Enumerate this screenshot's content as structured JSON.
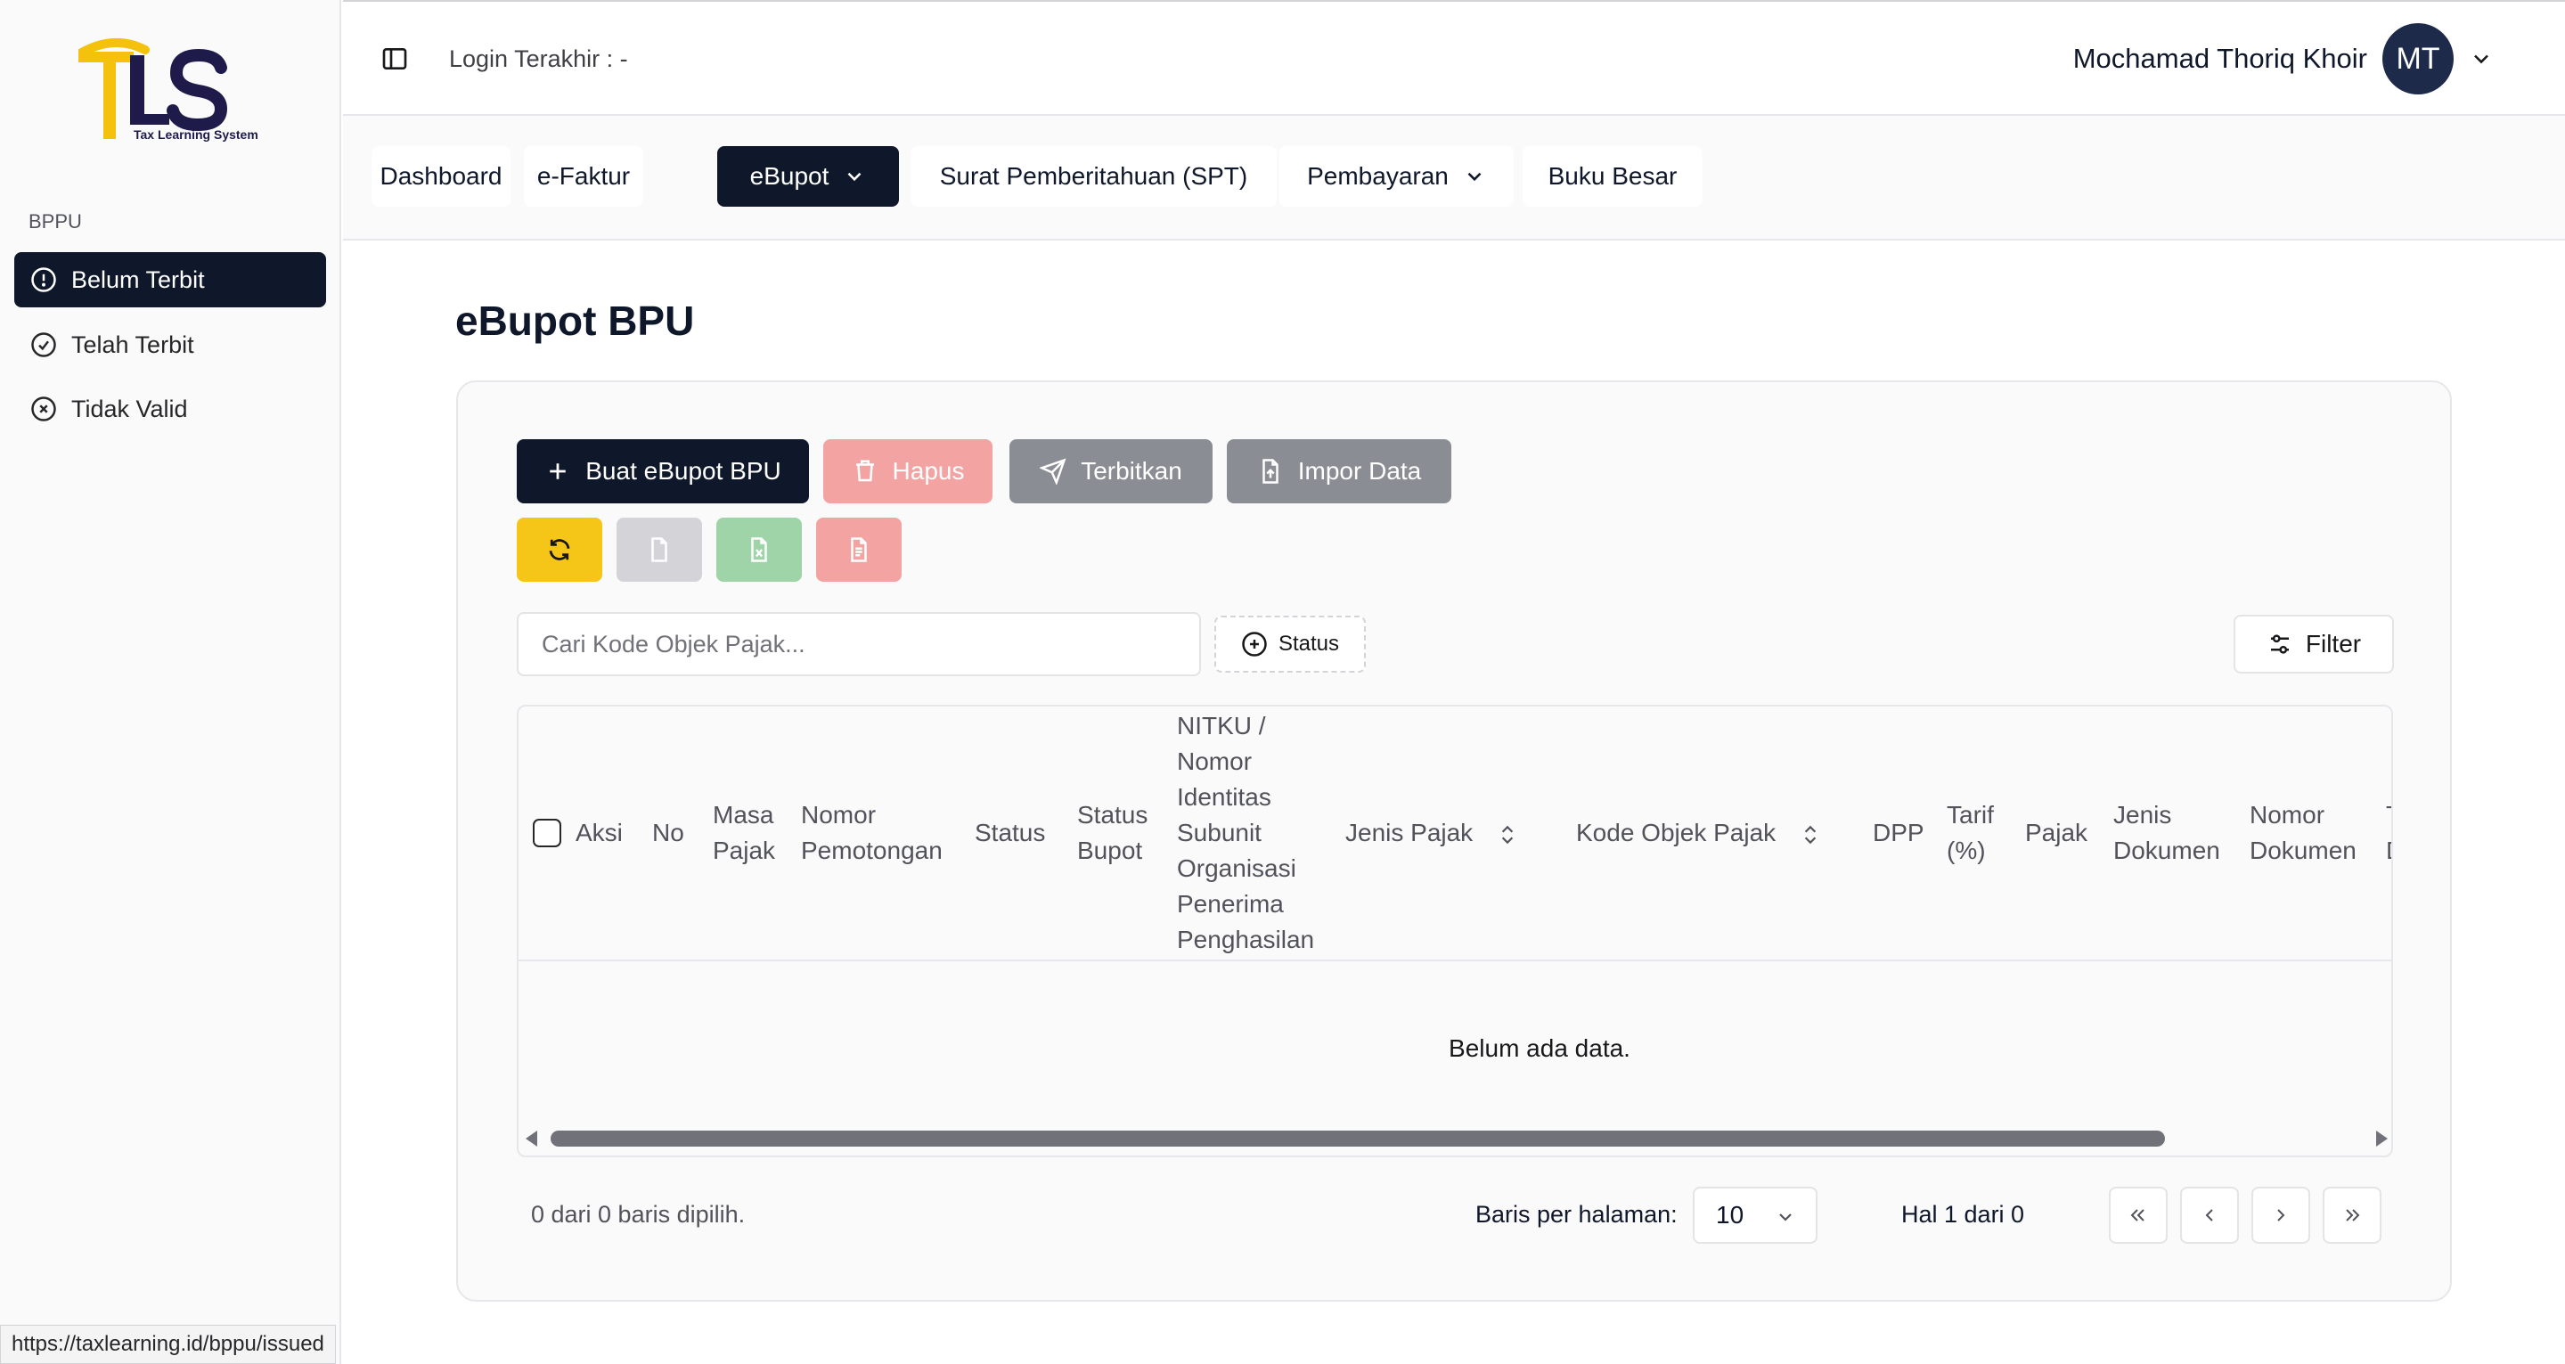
{
  "brand": {
    "logo_text": "TLS",
    "tagline": "Tax Learning System",
    "colors": {
      "gold": "#f4c20d",
      "navy": "#1e1b4b"
    }
  },
  "sidebar": {
    "section_label": "BPPU",
    "items": [
      {
        "label": "Belum Terbit",
        "icon": "alert-circle-icon",
        "active": true
      },
      {
        "label": "Telah Terbit",
        "icon": "check-circle-icon",
        "active": false
      },
      {
        "label": "Tidak Valid",
        "icon": "x-circle-icon",
        "active": false
      }
    ]
  },
  "header": {
    "login_text": "Login Terakhir : -",
    "user_name": "Mochamad Thoriq Khoir",
    "avatar_initials": "MT"
  },
  "nav": {
    "tabs": [
      {
        "label": "Dashboard",
        "active": false,
        "has_dropdown": false
      },
      {
        "label": "e-Faktur",
        "active": false,
        "has_dropdown": false
      },
      {
        "label": "eBupot",
        "active": true,
        "has_dropdown": true
      },
      {
        "label": "Surat Pemberitahuan (SPT)",
        "active": false,
        "has_dropdown": false
      },
      {
        "label": "Pembayaran",
        "active": false,
        "has_dropdown": true
      },
      {
        "label": "Buku Besar",
        "active": false,
        "has_dropdown": false
      }
    ]
  },
  "page": {
    "title": "eBupot BPU"
  },
  "toolbar": {
    "create_label": "Buat eBupot BPU",
    "delete_label": "Hapus",
    "publish_label": "Terbitkan",
    "import_label": "Impor Data",
    "colors": {
      "create": "#0f172a",
      "delete": "#f4a3a3",
      "publish": "#8a8d93",
      "import": "#8a8d93",
      "refresh": "#f5c518",
      "pdf": "#d4d4d8",
      "excel": "#9fd3a8",
      "report": "#f4a3a3"
    }
  },
  "filters": {
    "search_placeholder": "Cari Kode Objek Pajak...",
    "status_label": "Status",
    "filter_label": "Filter"
  },
  "table": {
    "headers": {
      "aksi": "Aksi",
      "no": "No",
      "masa_1": "Masa",
      "masa_2": "Pajak",
      "nomor_pemotongan_1": "Nomor",
      "nomor_pemotongan_2": "Pemotongan",
      "status": "Status",
      "status_bupot_1": "Status",
      "status_bupot_2": "Bupot",
      "nitku_1": "NITKU /",
      "nitku_2": "Nomor",
      "nitku_3": "Identitas",
      "nitku_4": "Subunit",
      "nitku_5": "Organisasi",
      "nitku_6": "Penerima",
      "nitku_7": "Penghasilan",
      "jenis_pajak": "Jenis Pajak",
      "kode_objek_pajak": "Kode Objek Pajak",
      "dpp": "DPP",
      "tarif_1": "Tarif",
      "tarif_2": "(%)",
      "pajak": "Pajak",
      "jenis_dokumen_1": "Jenis",
      "jenis_dokumen_2": "Dokumen",
      "nomor_dokumen_1": "Nomor",
      "nomor_dokumen_2": "Dokumen",
      "tanggal_1": "T",
      "tanggal_2": "D"
    },
    "rows": [],
    "empty_text": "Belum ada data."
  },
  "pagination": {
    "selected_text": "0 dari 0 baris dipilih.",
    "rows_per_page_label": "Baris per halaman:",
    "rows_per_page_value": "10",
    "page_info": "Hal 1 dari 0"
  },
  "statusbar": {
    "url": "https://taxlearning.id/bppu/issued"
  }
}
